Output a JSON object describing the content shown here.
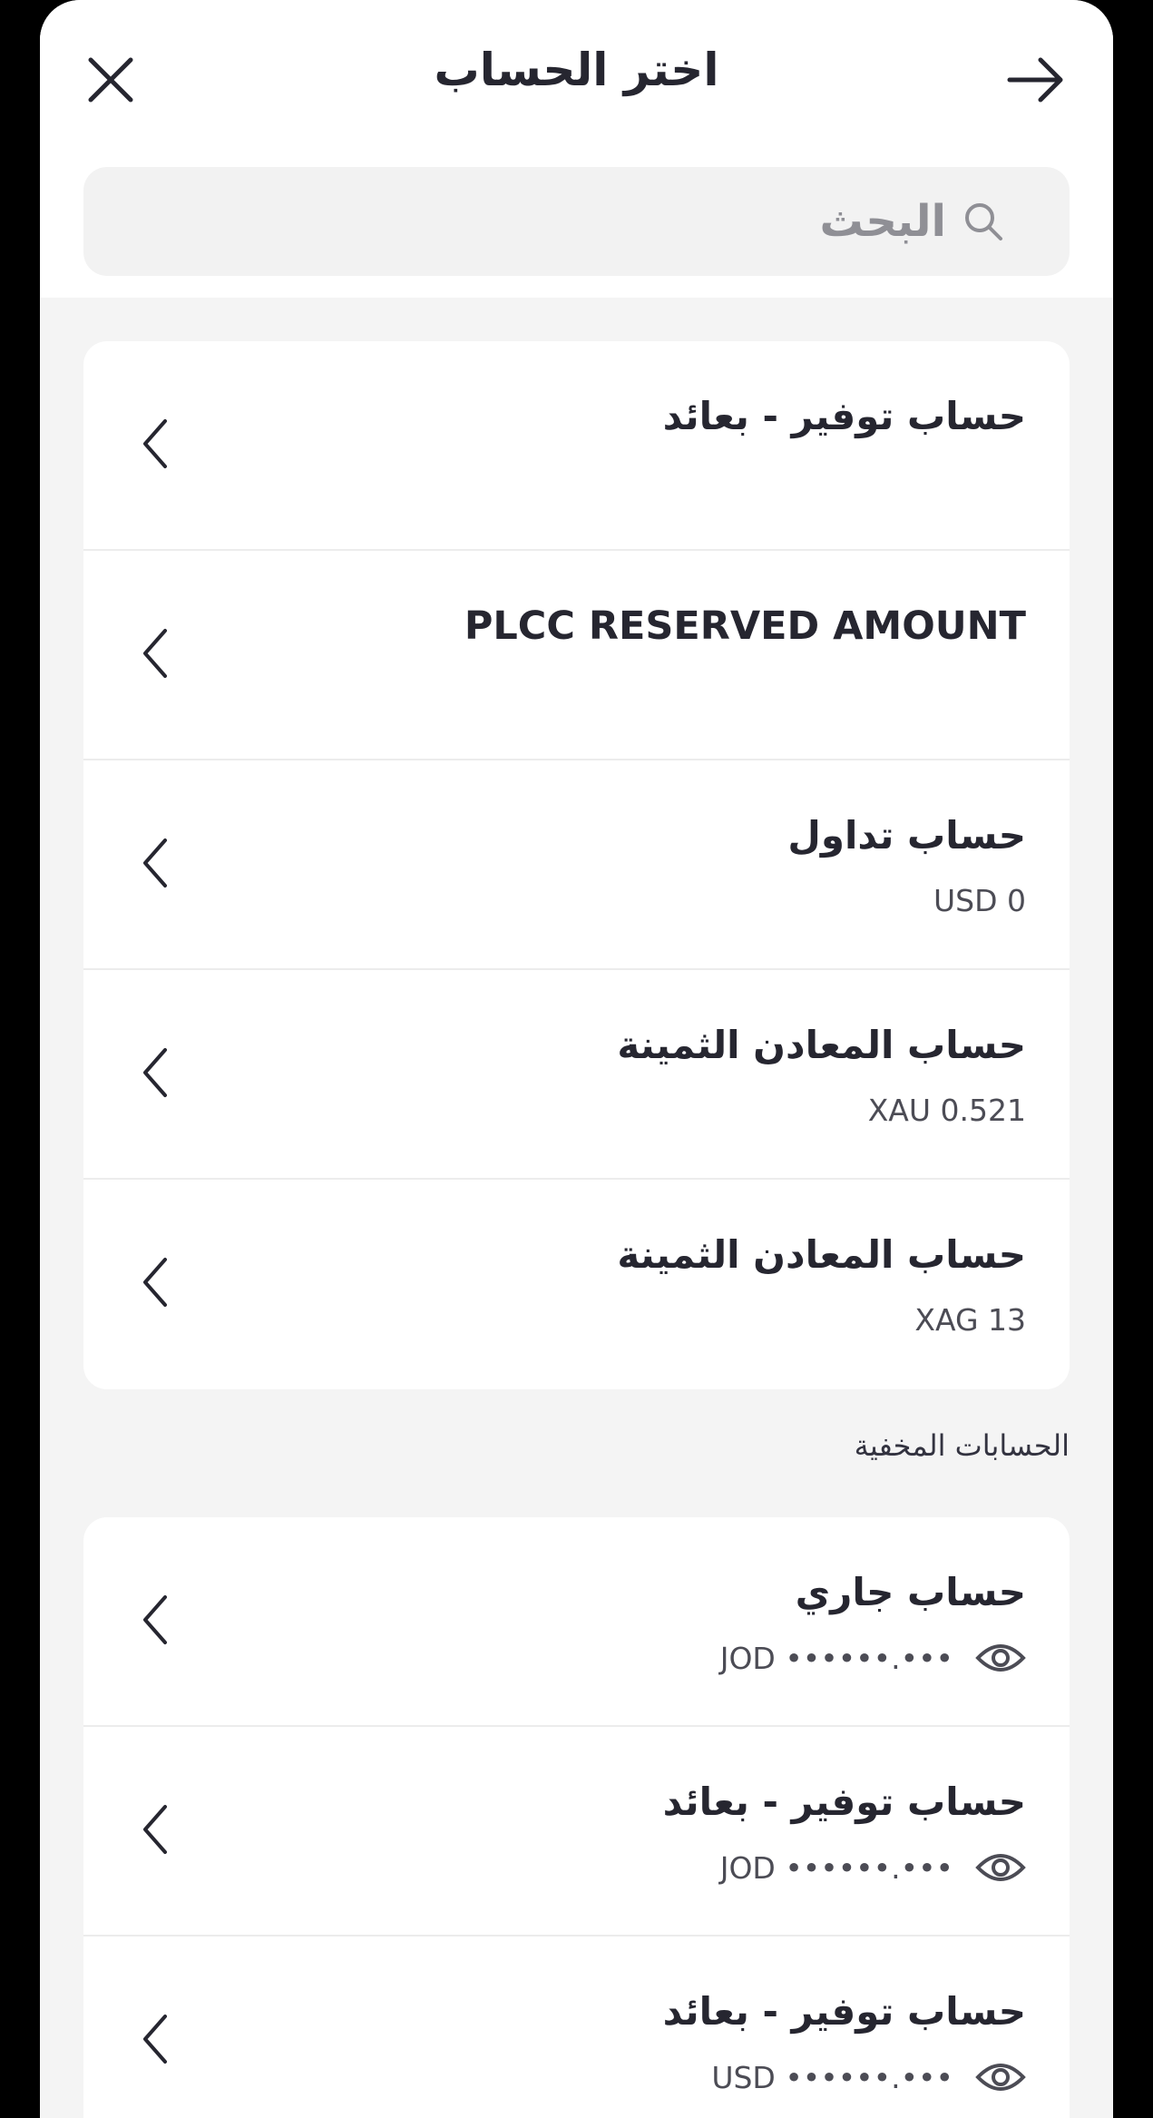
{
  "header": {
    "title": "اختر الحساب",
    "close_icon": "close-icon",
    "forward_icon": "arrow-right-icon"
  },
  "search": {
    "placeholder": "البحث",
    "icon": "search-icon"
  },
  "accounts": [
    {
      "name": "حساب توفير - بعائد",
      "amount": ""
    },
    {
      "name": "PLCC RESERVED AMOUNT",
      "amount": ""
    },
    {
      "name": "حساب تداول",
      "amount": "USD 0"
    },
    {
      "name": "حساب المعادن الثمينة",
      "amount": "XAU 0.521"
    },
    {
      "name": "حساب المعادن الثمينة",
      "amount": "XAG 13"
    }
  ],
  "hidden_section": {
    "label": "الحسابات المخفية",
    "accounts": [
      {
        "name": "حساب جاري",
        "amount": "JOD ••••••.•••"
      },
      {
        "name": "حساب توفير - بعائد",
        "amount": "JOD ••••••.•••"
      },
      {
        "name": "حساب توفير - بعائد",
        "amount": "USD ••••••.•••"
      }
    ]
  },
  "colors": {
    "background": "#f4f4f4",
    "card": "#ffffff",
    "text": "#262630",
    "muted": "#8f8f95"
  }
}
